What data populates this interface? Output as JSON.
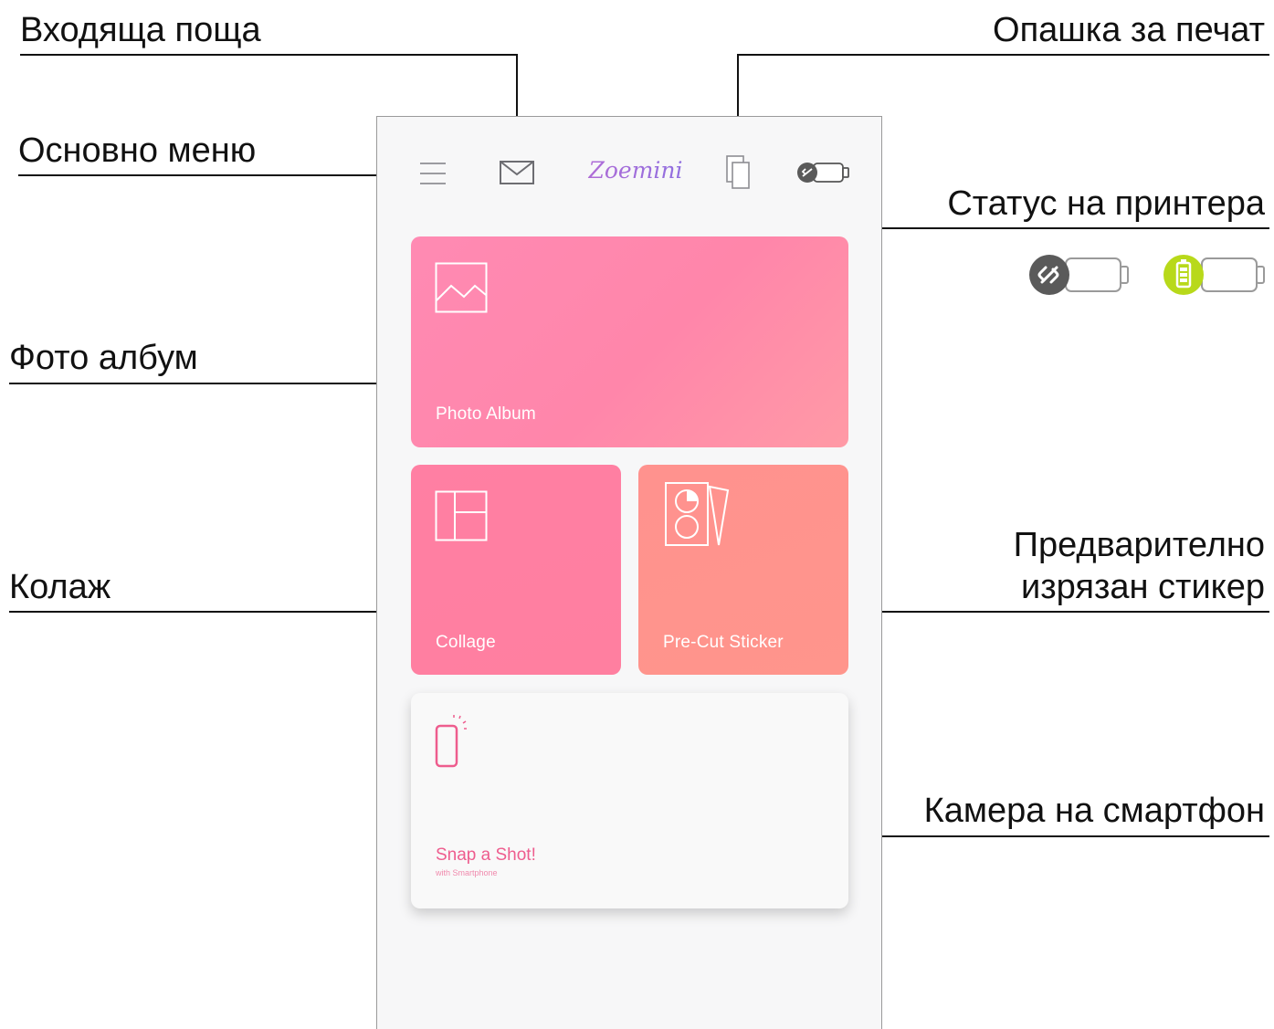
{
  "callouts": {
    "inbox": "Входяща поща",
    "print_queue": "Опашка за печат",
    "main_menu": "Основно меню",
    "printer_status": "Статус на принтера",
    "photo_album": "Фото албум",
    "collage": "Колаж",
    "precut_sticker_line1": "Предварително",
    "precut_sticker_line2": "изрязан стикер",
    "smartphone_camera": "Камера на смартфон"
  },
  "app": {
    "logo": "Zoemini",
    "cards": {
      "photo_album": "Photo Album",
      "collage": "Collage",
      "precut_sticker": "Pre-Cut Sticker",
      "snap_title": "Snap a Shot!",
      "snap_subtitle": "with Smartphone"
    }
  },
  "icons": {
    "menu": "hamburger-icon",
    "inbox": "envelope-icon",
    "print_queue": "pages-icon",
    "printer": "printer-status-icon",
    "album": "image-icon",
    "collage": "grid-icon",
    "sticker": "sticker-sheet-icon",
    "snap": "phone-icon"
  },
  "colors": {
    "album_card": "#ff8ab3",
    "collage_card": "#ff7fa3",
    "sticker_card": "#ff928e",
    "snap_text": "#ee5d8e",
    "battery_ok": "#b8d91a",
    "disconnected": "#5a5a5a"
  }
}
